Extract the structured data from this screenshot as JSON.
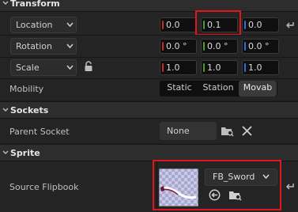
{
  "transform": {
    "header": "Transform",
    "location": {
      "label": "Location",
      "x": "0.0",
      "y": "0.1",
      "z": "0.0"
    },
    "rotation": {
      "label": "Rotation",
      "x": "0.0 °",
      "y": "0.0 °",
      "z": "0.0 °"
    },
    "scale": {
      "label": "Scale",
      "x": "1.0",
      "y": "1.0",
      "z": "1.0"
    },
    "mobility": {
      "label": "Mobility",
      "options": [
        "Static",
        "Station",
        "Movab"
      ],
      "selected": "Movab"
    }
  },
  "sockets": {
    "header": "Sockets",
    "parent_socket": {
      "label": "Parent Socket",
      "value": "None"
    }
  },
  "sprite": {
    "header": "Sprite",
    "source_flipbook": {
      "label": "Source Flipbook",
      "asset": "FB_Sword"
    }
  },
  "colors": {
    "x_axis": "#c42b2b",
    "y_axis": "#4f9c2a",
    "z_axis": "#2f6fd6",
    "highlight": "#e0161a"
  }
}
